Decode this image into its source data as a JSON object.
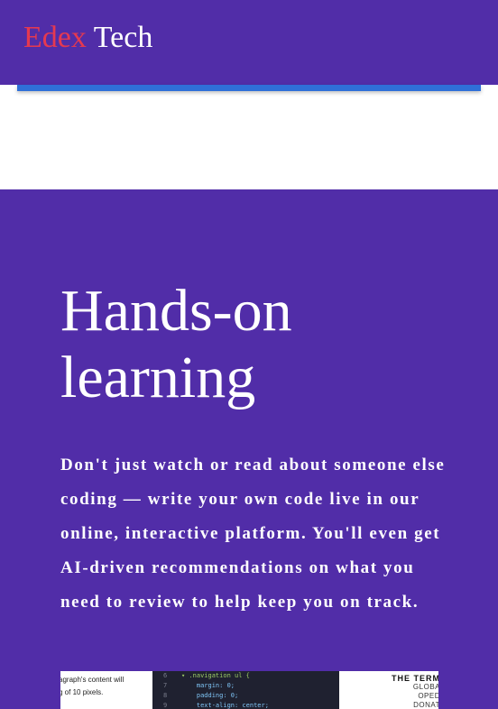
{
  "header": {
    "logo_part1": "Edex",
    "logo_part2": "Tech",
    "bg_color": "#512da8",
    "logo_accent_color": "#e53950",
    "bar_color": "#2f6fd8"
  },
  "hero": {
    "title": "Hands-on learning",
    "body": "Don't just watch or read about someone else coding — write your own code live in our online, interactive platform. You'll even get AI-driven recommendations on what you need to review to help keep you on track.",
    "bg_color": "#512da8"
  },
  "preview": {
    "left_lines": [
      "agraph's content will",
      "g  of 10 pixels."
    ],
    "code_lines": [
      {
        "ln": "6",
        "text": "▾ .navigation ul {"
      },
      {
        "ln": "7",
        "text": "    margin: 0;"
      },
      {
        "ln": "8",
        "text": "    padding: 0;"
      },
      {
        "ln": "9",
        "text": "    text-align: center;"
      }
    ],
    "right_title": "THE TERM",
    "right_lines": [
      "GLOBA",
      "OPED",
      "DONAT"
    ]
  }
}
